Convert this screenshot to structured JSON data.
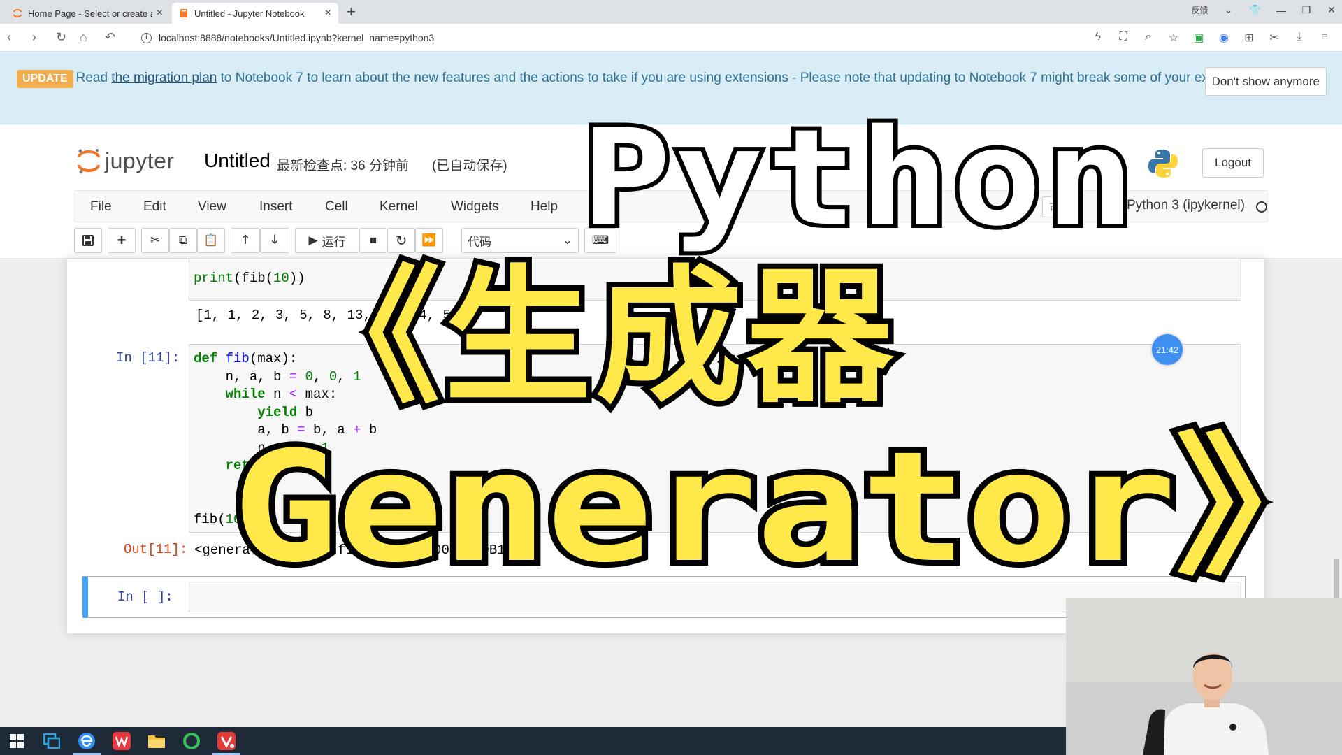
{
  "browser": {
    "tabs": [
      {
        "title": "Home Page - Select or create a notebook"
      },
      {
        "title": "Untitled - Jupyter Notebook"
      }
    ],
    "url": "localhost:8888/notebooks/Untitled.ipynb?kernel_name=python3",
    "feedback_label": "反馈"
  },
  "banner": {
    "badge": "UPDATE",
    "text_before": "Read ",
    "link": "the migration plan",
    "text_after": " to Notebook 7 to learn about the new features and the actions to take if you are using extensions - Please note that updating to Notebook 7 might break some of your extensions.",
    "dismiss": "Don't show anymore"
  },
  "header": {
    "logo_text": "jupyter",
    "notebook_name": "Untitled",
    "checkpoint": "最新检查点: 36 分钟前",
    "autosave": "(已自动保存)",
    "logout": "Logout"
  },
  "menu": {
    "items": [
      "File",
      "Edit",
      "View",
      "Insert",
      "Cell",
      "Kernel",
      "Widgets",
      "Help"
    ],
    "trusted": "可信",
    "kernel": "Python 3 (ipykernel)"
  },
  "toolbar": {
    "run_label": "运行",
    "cell_type": "代码"
  },
  "cells": {
    "prev_code": "print(fib(10))",
    "prev_output": "[1, 1, 2, 3, 5, 8, 13, 21, 34, 55]",
    "cell11_prompt": "In  [11]:",
    "cell11_out_prompt": "Out[11]:",
    "cell11_output": "<generator object fib at 0x000002C1B0B1C40>",
    "empty_prompt": "In  [ ]:"
  },
  "timer_badge": "21:42",
  "overlay": {
    "line1": "Python",
    "line2": "《生成器",
    "line3": "Generator》"
  },
  "colors": {
    "banner_bg": "#d9edf7",
    "update_badge": "#f0ad4e",
    "title_yellow": "#ffe94a",
    "in_prompt": "#303f9f",
    "out_prompt": "#d84315"
  }
}
